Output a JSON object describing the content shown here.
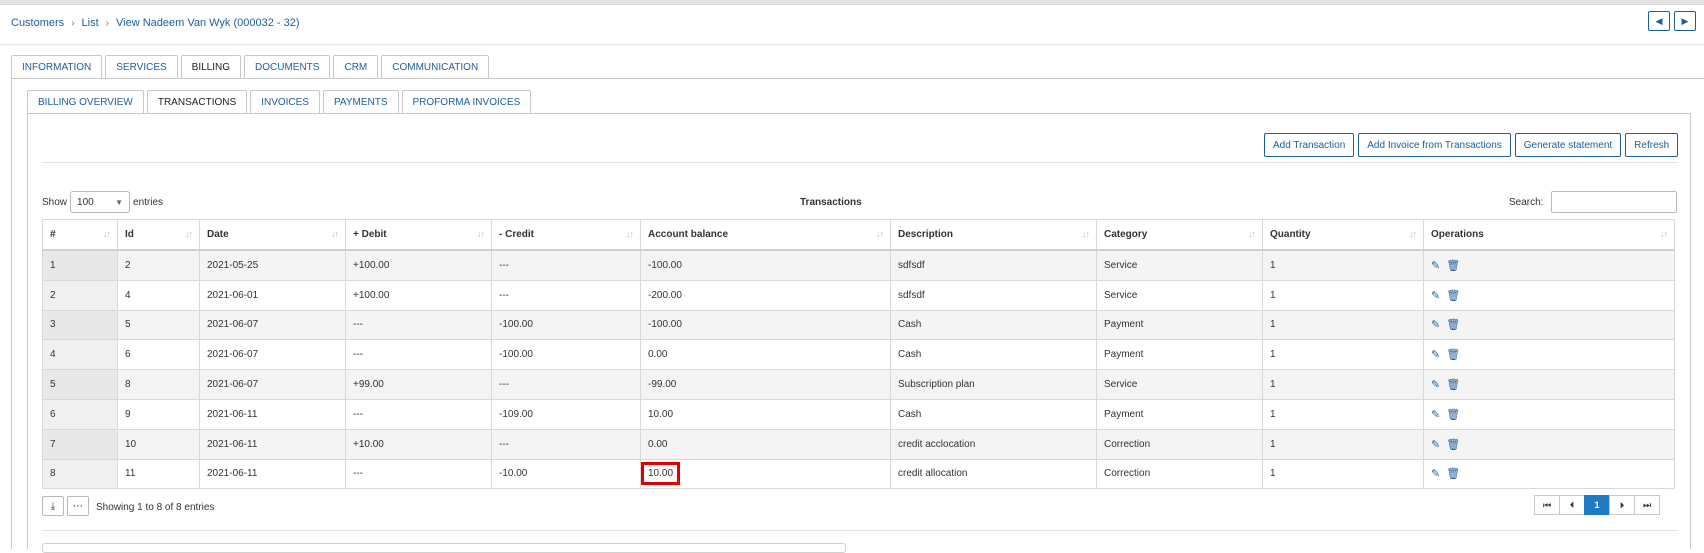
{
  "breadcrumb": [
    "Customers",
    "List",
    "View Nadeem Van Wyk (000032 - 32)"
  ],
  "nav": {
    "prev_icon": "triangle-left",
    "next_icon": "triangle-right"
  },
  "main_tabs": [
    {
      "label": "INFORMATION",
      "active": false
    },
    {
      "label": "SERVICES",
      "active": false
    },
    {
      "label": "BILLING",
      "active": true
    },
    {
      "label": "DOCUMENTS",
      "active": false
    },
    {
      "label": "CRM",
      "active": false
    },
    {
      "label": "COMMUNICATION",
      "active": false
    }
  ],
  "billing_tabs": [
    {
      "label": "BILLING OVERVIEW",
      "active": false
    },
    {
      "label": "TRANSACTIONS",
      "active": true
    },
    {
      "label": "INVOICES",
      "active": false
    },
    {
      "label": "PAYMENTS",
      "active": false
    },
    {
      "label": "PROFORMA INVOICES",
      "active": false
    }
  ],
  "actions": [
    "Add Transaction",
    "Add Invoice from Transactions",
    "Generate statement",
    "Refresh"
  ],
  "length_menu": {
    "show_label": "Show",
    "value": "100",
    "entries_label": "entries"
  },
  "table_title": "Transactions",
  "search": {
    "label": "Search:",
    "value": ""
  },
  "columns": [
    "#",
    "Id",
    "Date",
    "+ Debit",
    "- Credit",
    "Account balance",
    "Description",
    "Category",
    "Quantity",
    "Operations"
  ],
  "rows": [
    [
      "1",
      "2",
      "2021-05-25",
      "+100.00",
      "---",
      "-100.00",
      "sdfsdf",
      "Service",
      "1"
    ],
    [
      "2",
      "4",
      "2021-06-01",
      "+100.00",
      "---",
      "-200.00",
      "sdfsdf",
      "Service",
      "1"
    ],
    [
      "3",
      "5",
      "2021-06-07",
      "---",
      "-100.00",
      "-100.00",
      "Cash",
      "Payment",
      "1"
    ],
    [
      "4",
      "6",
      "2021-06-07",
      "---",
      "-100.00",
      "0.00",
      "Cash",
      "Payment",
      "1"
    ],
    [
      "5",
      "8",
      "2021-06-07",
      "+99.00",
      "---",
      "-99.00",
      "Subscription plan",
      "Service",
      "1"
    ],
    [
      "6",
      "9",
      "2021-06-11",
      "---",
      "-109.00",
      "10.00",
      "Cash",
      "Payment",
      "1"
    ],
    [
      "7",
      "10",
      "2021-06-11",
      "+10.00",
      "---",
      "0.00",
      "credit acclocation",
      "Correction",
      "1"
    ],
    [
      "8",
      "11",
      "2021-06-11",
      "---",
      "-10.00",
      "10.00",
      "credit allocation",
      "Correction",
      "1"
    ]
  ],
  "highlighted_cell": {
    "row": 7,
    "column": "Account balance",
    "color": "#e00000"
  },
  "row_operation_icons": [
    "edit-icon",
    "trash-icon"
  ],
  "footer": {
    "info": "Showing 1 to 8 of 8 entries",
    "pages": [
      "1"
    ],
    "current_page": "1"
  },
  "colors": {
    "link": "#1e5e99",
    "accent": "#1e7bc2",
    "highlight": "#e00000"
  }
}
